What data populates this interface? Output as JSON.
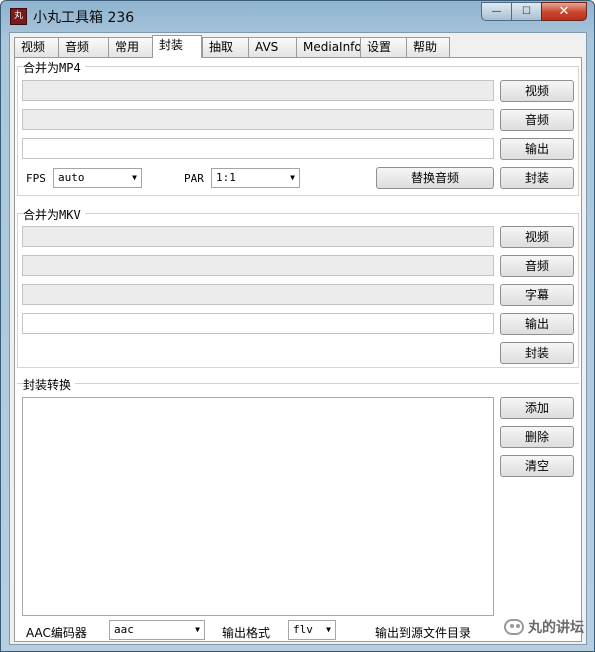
{
  "window": {
    "icon_text": "丸",
    "title": "小丸工具箱 236",
    "minimize": "—",
    "maximize": "☐",
    "close": "✕"
  },
  "tabs": [
    "视频",
    "音频",
    "常用",
    "封装",
    "抽取",
    "AVS",
    "MediaInfo",
    "设置",
    "帮助"
  ],
  "active_tab": "封装",
  "mp4": {
    "group_label": "合并为MP4",
    "video_button": "视频",
    "audio_button": "音频",
    "output_button": "输出",
    "fps_label": "FPS",
    "fps_value": "auto",
    "par_label": "PAR",
    "par_value": "1:1",
    "replace_audio_button": "替换音频",
    "mux_button": "封装"
  },
  "mkv": {
    "group_label": "合并为MKV",
    "video_button": "视频",
    "audio_button": "音频",
    "subtitle_button": "字幕",
    "output_button": "输出",
    "mux_button": "封装"
  },
  "convert": {
    "group_label": "封装转换",
    "add_button": "添加",
    "delete_button": "删除",
    "clear_button": "清空",
    "aac_label": "AAC编码器",
    "aac_value": "aac",
    "format_label": "输出格式",
    "format_value": "flv",
    "output_to_source_label": "输出到源文件目录"
  },
  "watermark": "丸的讲坛"
}
